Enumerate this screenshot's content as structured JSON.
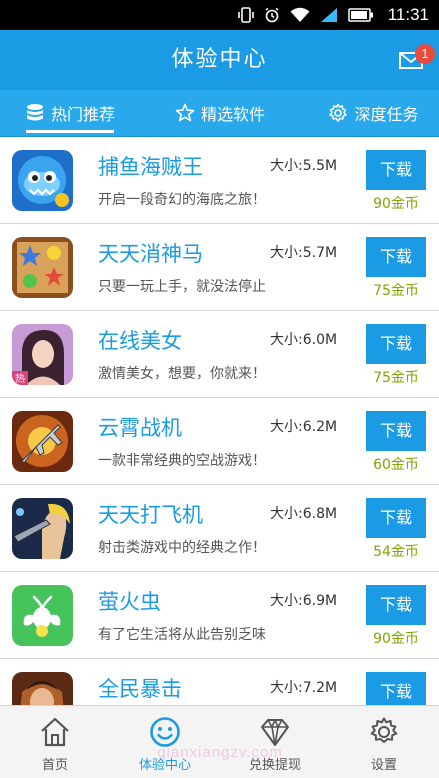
{
  "status_bar": {
    "time": "11:31"
  },
  "header": {
    "title": "体验中心",
    "mail_badge": "1"
  },
  "tabs": [
    {
      "label": "热门推荐",
      "icon": "database-icon",
      "active": true
    },
    {
      "label": "精选软件",
      "icon": "star-icon",
      "active": false
    },
    {
      "label": "深度任务",
      "icon": "gear-icon",
      "active": false
    }
  ],
  "apps": [
    {
      "name": "捕鱼海贼王",
      "size": "大小:5.5M",
      "desc": "开启一段奇幻的海底之旅！",
      "button": "下载",
      "coins": "90金币",
      "icon": "fish-game-icon"
    },
    {
      "name": "天天消神马",
      "size": "大小:5.7M",
      "desc": "只要一玩上手，就没法停止",
      "button": "下载",
      "coins": "75金币",
      "icon": "match-puzzle-icon"
    },
    {
      "name": "在线美女",
      "size": "大小:6.0M",
      "desc": "激情美女，想要，你就来！",
      "button": "下载",
      "coins": "75金币",
      "icon": "portrait-icon",
      "tag": "热"
    },
    {
      "name": "云霄战机",
      "size": "大小:6.2M",
      "desc": "一款非常经典的空战游戏！",
      "button": "下载",
      "coins": "60金币",
      "icon": "fighter-jet-icon"
    },
    {
      "name": "天天打飞机",
      "size": "大小:6.8M",
      "desc": "射击类游戏中的经典之作！",
      "button": "下载",
      "coins": "54金币",
      "icon": "shooter-game-icon"
    },
    {
      "name": "萤火虫",
      "size": "大小:6.9M",
      "desc": "有了它生活将从此告别乏味",
      "button": "下载",
      "coins": "90金币",
      "icon": "firefly-icon"
    },
    {
      "name": "全民暴击",
      "size": "大小:7.2M",
      "desc": "",
      "button": "下载",
      "coins": "",
      "icon": "warrior-game-icon"
    }
  ],
  "bottom_nav": [
    {
      "label": "首页",
      "icon": "home-icon",
      "active": false
    },
    {
      "label": "体验中心",
      "icon": "smiley-icon",
      "active": true
    },
    {
      "label": "兑换提现",
      "icon": "diamond-icon",
      "active": false
    },
    {
      "label": "设置",
      "icon": "gear-icon",
      "active": false
    }
  ],
  "watermark": "qianxiangzv.com",
  "colors": {
    "primary": "#1a9be3",
    "tab_bar": "#29a8ec",
    "coins": "#7fa600",
    "badge": "#e84a3c"
  }
}
